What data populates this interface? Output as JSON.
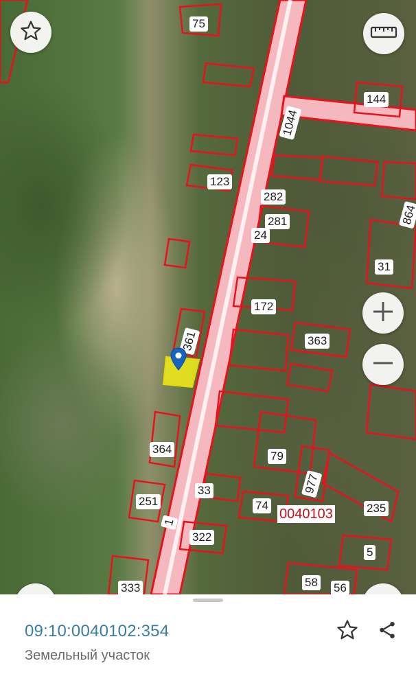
{
  "map": {
    "parcel_labels": [
      "75",
      "144",
      "1044",
      "123",
      "282",
      "281",
      "24",
      "864",
      "31",
      "172",
      "361",
      "363",
      "364",
      "79",
      "33",
      "977",
      "251",
      "74",
      "235",
      "322",
      "5",
      "333",
      "58",
      "56",
      "1"
    ],
    "quarter_label": "0040103"
  },
  "controls": {
    "favorite_icon": "star-outline-icon",
    "ruler_icon": "ruler-icon",
    "zoom_in_icon": "plus-icon",
    "zoom_out_icon": "minus-icon",
    "location_icon": "map-pin-icon"
  },
  "details": {
    "cadastral_number": "09:10:0040102:354",
    "type": "Земельный участок",
    "favorite_icon": "star-outline-icon",
    "share_icon": "share-icon"
  },
  "colors": {
    "parcel_outline": "#e8121c",
    "road_fill": "#f6b8bf",
    "selected_parcel": "#f4ee1a",
    "link_blue": "#3a7ea6",
    "pin_blue": "#1565c0"
  }
}
